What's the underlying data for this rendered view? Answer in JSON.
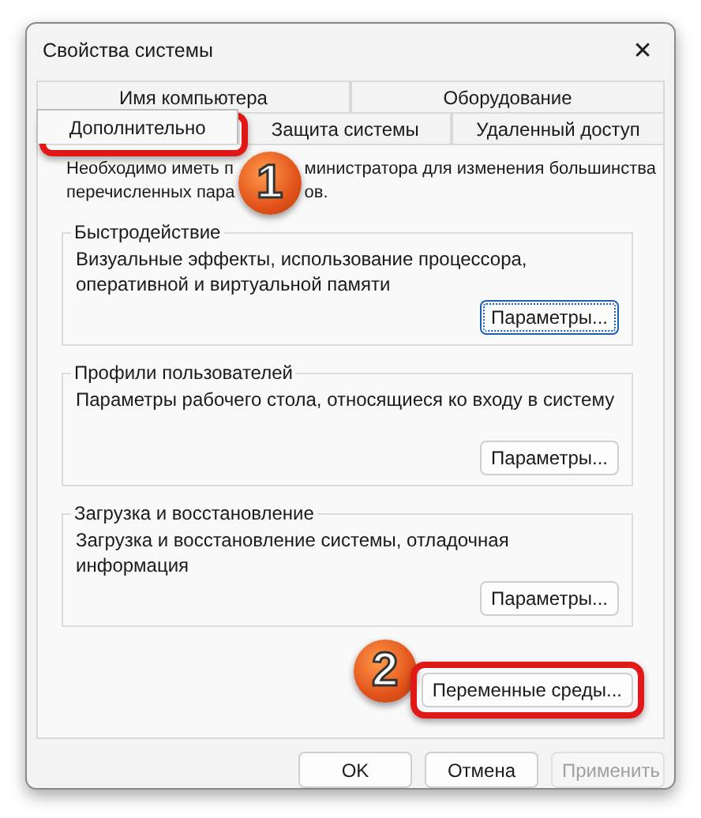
{
  "window": {
    "title": "Свойства системы",
    "close": "✕"
  },
  "tab_rows": [
    [
      {
        "label": "Имя компьютера",
        "selected": false
      },
      {
        "label": "Оборудование",
        "selected": false
      }
    ],
    [
      {
        "label": "Дополнительно",
        "selected": true
      },
      {
        "label": "Защита системы",
        "selected": false
      },
      {
        "label": "Удаленный доступ",
        "selected": false
      }
    ]
  ],
  "intro_left": [
    "Необходимо иметь п",
    "перечисленных пара"
  ],
  "intro_right": [
    "министратора для изменения большинства",
    "ов."
  ],
  "groups": [
    {
      "title": "Быстродействие",
      "text": "Визуальные эффекты, использование процессора, оперативной и виртуальной памяти",
      "button": "Параметры...",
      "focused": true
    },
    {
      "title": "Профили пользователей",
      "text": "Параметры рабочего стола, относящиеся ко входу в систему",
      "button": "Параметры...",
      "focused": false
    },
    {
      "title": "Загрузка и восстановление",
      "text": "Загрузка и восстановление системы, отладочная информация",
      "button": "Параметры...",
      "focused": false
    }
  ],
  "env_button": "Переменные среды...",
  "buttons": [
    {
      "label": "OK",
      "disabled": false
    },
    {
      "label": "Отмена",
      "disabled": false
    },
    {
      "label": "Применить",
      "disabled": true
    }
  ],
  "callouts": [
    {
      "label": "1"
    },
    {
      "label": "2"
    }
  ]
}
